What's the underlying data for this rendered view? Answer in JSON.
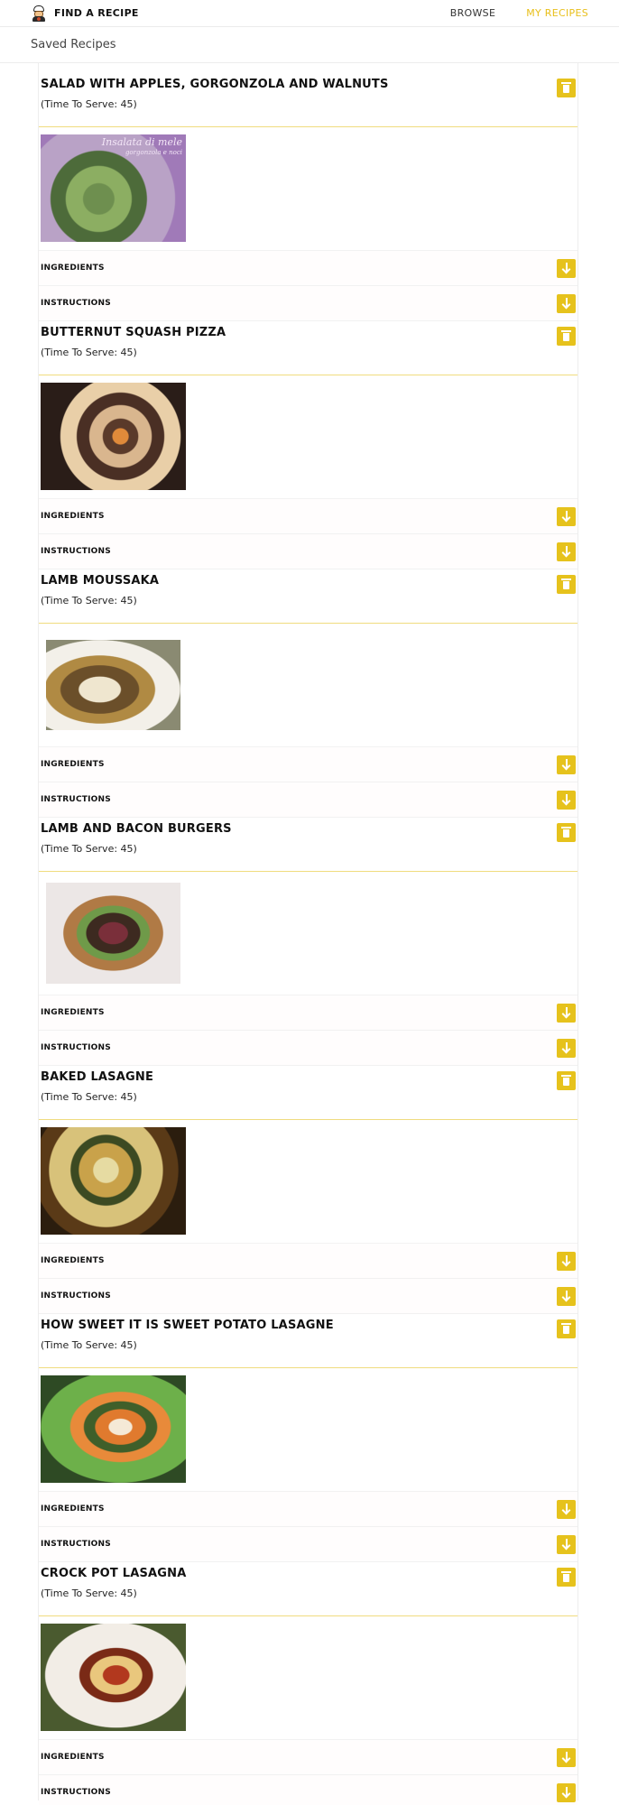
{
  "navbar": {
    "brand_title": "FIND A RECIPE",
    "links": [
      {
        "label": "BROWSE",
        "active": false
      },
      {
        "label": "MY RECIPES",
        "active": true
      }
    ],
    "accent_color": "#e8bf1a"
  },
  "page": {
    "subtitle": "Saved Recipes"
  },
  "recipes": [
    {
      "title": "SALAD WITH APPLES, GORGONZOLA AND WALNUTS",
      "time": "(Time To Serve: 45)",
      "image_caption": "Insalata di mele",
      "image_subcaption": "gorgonzola e noci",
      "ingredients_label": "INGREDIENTS",
      "instructions_label": "INSTRUCTIONS"
    },
    {
      "title": "BUTTERNUT SQUASH PIZZA",
      "time": "(Time To Serve: 45)",
      "ingredients_label": "INGREDIENTS",
      "instructions_label": "INSTRUCTIONS"
    },
    {
      "title": "LAMB MOUSSAKA",
      "time": "(Time To Serve: 45)",
      "ingredients_label": "INGREDIENTS",
      "instructions_label": "INSTRUCTIONS"
    },
    {
      "title": "LAMB AND BACON BURGERS",
      "time": "(Time To Serve: 45)",
      "ingredients_label": "INGREDIENTS",
      "instructions_label": "INSTRUCTIONS"
    },
    {
      "title": "BAKED LASAGNE",
      "time": "(Time To Serve: 45)",
      "ingredients_label": "INGREDIENTS",
      "instructions_label": "INSTRUCTIONS"
    },
    {
      "title": "HOW SWEET IT IS SWEET POTATO LASAGNE",
      "time": "(Time To Serve: 45)",
      "ingredients_label": "INGREDIENTS",
      "instructions_label": "INSTRUCTIONS"
    },
    {
      "title": "CROCK POT LASAGNA",
      "time": "(Time To Serve: 45)",
      "ingredients_label": "INGREDIENTS",
      "instructions_label": "INSTRUCTIONS"
    }
  ],
  "icons": {
    "brand": "chef-icon",
    "delete": "trash-icon",
    "expand": "arrow-down-icon"
  },
  "colors": {
    "button": "#e6c21c",
    "divider": "#f0dc7f"
  }
}
